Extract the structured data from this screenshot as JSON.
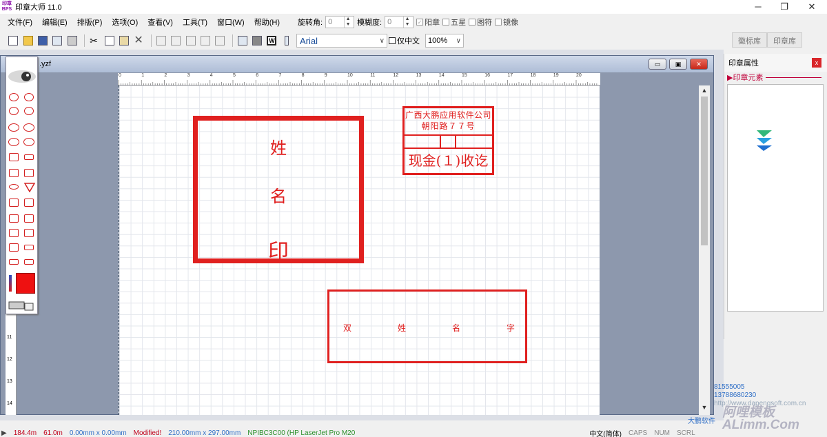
{
  "window": {
    "title": "印章大师 11.0",
    "app_icon": "stamp-app-icon"
  },
  "menu": [
    "文件(F)",
    "编辑(E)",
    "排版(P)",
    "选项(O)",
    "查看(V)",
    "工具(T)",
    "窗口(W)",
    "帮助(H)"
  ],
  "rotation": {
    "label": "旋转角:",
    "value": "0",
    "blur_label": "模糊度:",
    "blur_value": "0"
  },
  "options": {
    "yang": "阳章",
    "five_star": "五星",
    "graphic": "图符",
    "mirror": "镜像"
  },
  "font": {
    "family": "Arial",
    "only_chinese": "仅中文",
    "zoom": "100%"
  },
  "right_tabs": [
    "徽标库",
    "印章库"
  ],
  "props": {
    "title": "印章属性",
    "elements": "▶印章元素"
  },
  "document": {
    "name": ".yzf"
  },
  "ruler_ticks": [
    "0",
    "1",
    "2",
    "3",
    "4",
    "5",
    "6",
    "7",
    "8",
    "9",
    "10",
    "11",
    "12",
    "13",
    "14",
    "15",
    "16",
    "17",
    "18",
    "19",
    "20"
  ],
  "vruler_ticks": [
    "11",
    "12",
    "13",
    "14"
  ],
  "stamps": {
    "name_stamp": [
      "姓",
      "名",
      "印"
    ],
    "company_line1": "广西大鹏应用软件公司",
    "company_line2": "朝阳路７７号",
    "cash_text": "现金(１)收讫",
    "double_name": [
      "双",
      "姓",
      "名",
      "字"
    ]
  },
  "info": {
    "phone1": "81555005",
    "phone2": "13788680230",
    "website": "http://www.dapengsoft.com.cn",
    "author": "大鹏软件"
  },
  "status": {
    "x": "184.4m",
    "y": "61.0m",
    "sel": "0.00mm x 0.00mm",
    "modified": "Modified!",
    "paper": "210.00mm x 297.00mm",
    "printer": "NPIBC3C00 (HP LaserJet Pro M20",
    "ime": "中文(简体)",
    "caps": "CAPS",
    "num": "NUM",
    "scrl": "SCRL"
  },
  "watermark": "阿哩模板 ALimm.Com",
  "colors": {
    "stamp_red": "#e0201f"
  }
}
